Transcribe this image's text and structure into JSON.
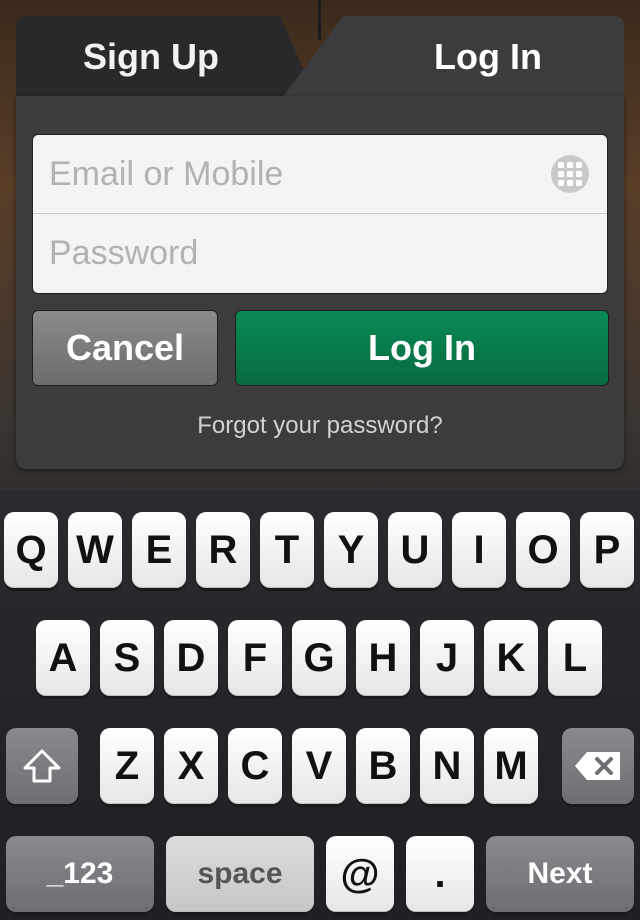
{
  "tabs": {
    "signup": "Sign Up",
    "login": "Log In"
  },
  "form": {
    "email_placeholder": "Email or Mobile",
    "password_placeholder": "Password",
    "cancel": "Cancel",
    "login": "Log In",
    "forgot": "Forgot your password?"
  },
  "keyboard": {
    "row1": [
      "Q",
      "W",
      "E",
      "R",
      "T",
      "Y",
      "U",
      "I",
      "O",
      "P"
    ],
    "row2": [
      "A",
      "S",
      "D",
      "F",
      "G",
      "H",
      "J",
      "K",
      "L"
    ],
    "row3": [
      "Z",
      "X",
      "C",
      "V",
      "B",
      "N",
      "M"
    ],
    "numbers": "_123",
    "space": "space",
    "at": "@",
    "dot": ".",
    "next": "Next"
  },
  "colors": {
    "accent_green": "#0a8a56",
    "panel": "#3c3c3e"
  }
}
